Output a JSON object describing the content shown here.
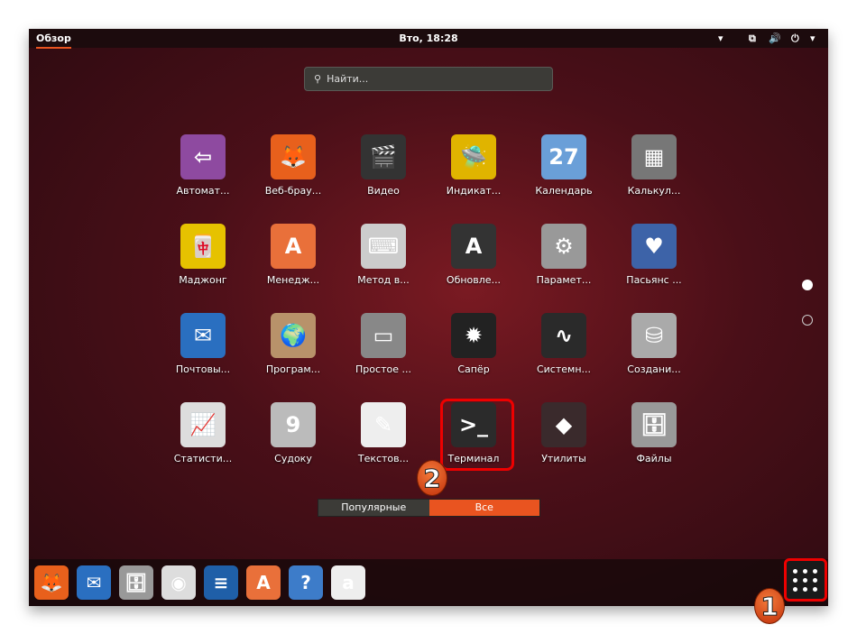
{
  "topbar": {
    "overview": "Обзор",
    "clock": "Вто, 18:28",
    "icons": [
      "chevron-down-icon",
      "network-icon",
      "volume-icon",
      "power-icon",
      "chevron-down-icon"
    ]
  },
  "search": {
    "placeholder": "Найти..."
  },
  "apps": [
    {
      "label": "Автомат...",
      "color": "#8e4aa0",
      "glyph": "⇦"
    },
    {
      "label": "Веб-брау...",
      "color": "#e8601c",
      "glyph": "🦊"
    },
    {
      "label": "Видео",
      "color": "#333333",
      "glyph": "🎬"
    },
    {
      "label": "Индикат...",
      "color": "#e0b400",
      "glyph": "🛸"
    },
    {
      "label": "Календарь",
      "color": "#6a9fd8",
      "glyph": "27"
    },
    {
      "label": "Калькул...",
      "color": "#777777",
      "glyph": "▦"
    },
    {
      "label": "Маджонг",
      "color": "#e6c200",
      "glyph": "🀄"
    },
    {
      "label": "Менедж...",
      "color": "#e9703a",
      "glyph": "A"
    },
    {
      "label": "Метод в...",
      "color": "#cccccc",
      "glyph": "⌨"
    },
    {
      "label": "Обновле...",
      "color": "#333333",
      "glyph": "A"
    },
    {
      "label": "Парамет...",
      "color": "#999999",
      "glyph": "⚙"
    },
    {
      "label": "Пасьянс ...",
      "color": "#3d63a8",
      "glyph": "♥"
    },
    {
      "label": "Почтовы...",
      "color": "#2a6fc0",
      "glyph": "✉"
    },
    {
      "label": "Програм...",
      "color": "#b8926a",
      "glyph": "🌍"
    },
    {
      "label": "Простое ...",
      "color": "#888888",
      "glyph": "▭"
    },
    {
      "label": "Сапёр",
      "color": "#222222",
      "glyph": "✹"
    },
    {
      "label": "Системн...",
      "color": "#2a2a2a",
      "glyph": "∿"
    },
    {
      "label": "Создани...",
      "color": "#aaaaaa",
      "glyph": "⛁"
    },
    {
      "label": "Статисти...",
      "color": "#dddddd",
      "glyph": "📈"
    },
    {
      "label": "Судоку",
      "color": "#bbbbbb",
      "glyph": "9"
    },
    {
      "label": "Текстов...",
      "color": "#eeeeee",
      "glyph": "✎"
    },
    {
      "label": "Терминал",
      "color": "#2b2b2b",
      "glyph": ">_"
    },
    {
      "label": "Утилиты",
      "color": "#3a2a2c",
      "glyph": "◆"
    },
    {
      "label": "Файлы",
      "color": "#999999",
      "glyph": "🗄"
    }
  ],
  "tabs": {
    "popular": "Популярные",
    "all": "Все",
    "active": "all"
  },
  "pages": {
    "current": 1,
    "total": 2
  },
  "dock": [
    {
      "name": "firefox",
      "color": "#e8601c",
      "glyph": "🦊"
    },
    {
      "name": "thunderbird",
      "color": "#2a6fc0",
      "glyph": "✉"
    },
    {
      "name": "files",
      "color": "#999999",
      "glyph": "🗄"
    },
    {
      "name": "rhythmbox",
      "color": "#dddddd",
      "glyph": "◉"
    },
    {
      "name": "libreoffice-writer",
      "color": "#1f5fa8",
      "glyph": "≡"
    },
    {
      "name": "software",
      "color": "#e9703a",
      "glyph": "A"
    },
    {
      "name": "help",
      "color": "#3d7cc9",
      "glyph": "?"
    },
    {
      "name": "amazon",
      "color": "#eeeeee",
      "glyph": "a"
    }
  ],
  "annotations": {
    "step1": "1",
    "step2": "2"
  },
  "colors": {
    "accent": "#e95420",
    "highlight": "#ee0000"
  }
}
